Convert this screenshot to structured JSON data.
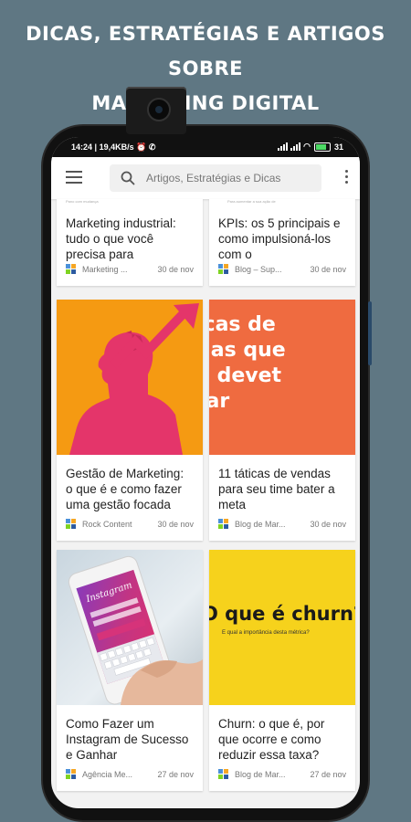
{
  "promo": {
    "line1": "DICAS, ESTRATÉGIAS E ARTIGOS SOBRE",
    "line2": "MARKETING DIGITAL"
  },
  "status_bar": {
    "time": "14:24",
    "speed": "19,4KB/s",
    "battery": "31"
  },
  "app_bar": {
    "search_placeholder": "Artigos, Estratégias e Dicas"
  },
  "colors": {
    "background": "#5f7783",
    "orange_thumb": "#ef6b40",
    "yellow_thumb": "#f6d21c",
    "amber_thumb": "#f59a12",
    "pink_figure": "#e4356a"
  },
  "cards": [
    {
      "title": "Marketing industrial: tudo o que você precisa para",
      "source": "Marketing ...",
      "date": "30 de nov",
      "caption": "Pano com mudança"
    },
    {
      "title": "KPIs: os 5 principais e como impulsioná-los com o",
      "source": "Blog – Sup...",
      "date": "30 de nov",
      "caption": "Para aumentar a sua ação de"
    },
    {
      "title": "Gestão de Marketing: o que é e como fazer uma gestão focada",
      "source": "Rock Content",
      "date": "30 de nov"
    },
    {
      "title": "11 táticas de vendas para seu time bater a meta",
      "source": "Blog de Mar...",
      "date": "30 de nov",
      "image_text": "icas de\ndas que\nê devet\ntar"
    },
    {
      "title": "Como Fazer um Instagram de Sucesso e Ganhar",
      "source": "Agência Me...",
      "date": "27 de nov",
      "image_text": "Instagram"
    },
    {
      "title": "Churn: o que é, por que ocorre e como reduzir essa taxa?",
      "source": "Blog de Mar...",
      "date": "27 de nov",
      "image_heading": "O que é churn?",
      "image_sub": "E qual a importância desta métrica?"
    }
  ]
}
